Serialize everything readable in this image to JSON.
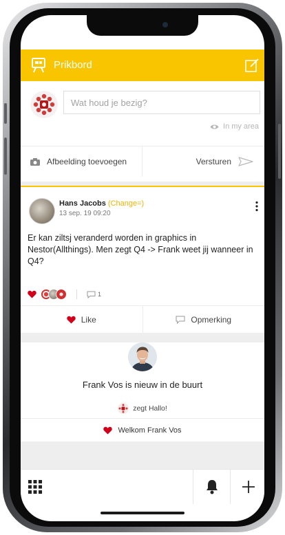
{
  "header": {
    "title": "Prikbord"
  },
  "composer": {
    "placeholder": "Wat houd je bezig?",
    "area_label": "In my area",
    "add_image_label": "Afbeelding toevoegen",
    "send_label": "Versturen"
  },
  "post": {
    "author": "Hans Jacobs",
    "change_label": "(Change=)",
    "timestamp": "13 sep. 19 09:20",
    "body": "Er kan ziltsj veranderd worden in graphics in Nestor(Allthings). Men zegt Q4  -> Frank weet jij wanneer in Q4?",
    "comment_count": "1",
    "like_label": "Like",
    "comment_label": "Opmerking"
  },
  "welcome": {
    "title": "Frank Vos is nieuw in de buurt",
    "hello_text": "zegt Hallo!",
    "welcome_label": "Welkom Frank Vos"
  },
  "colors": {
    "accent": "#f9c400",
    "heart": "#d0021b",
    "change": "#f0b400"
  },
  "icons": [
    "bulletin-board-icon",
    "edit-icon",
    "eye-icon",
    "camera-icon",
    "send-icon",
    "more-vertical-icon",
    "heart-icon",
    "comment-icon",
    "grid-icon",
    "bell-icon",
    "plus-icon"
  ]
}
